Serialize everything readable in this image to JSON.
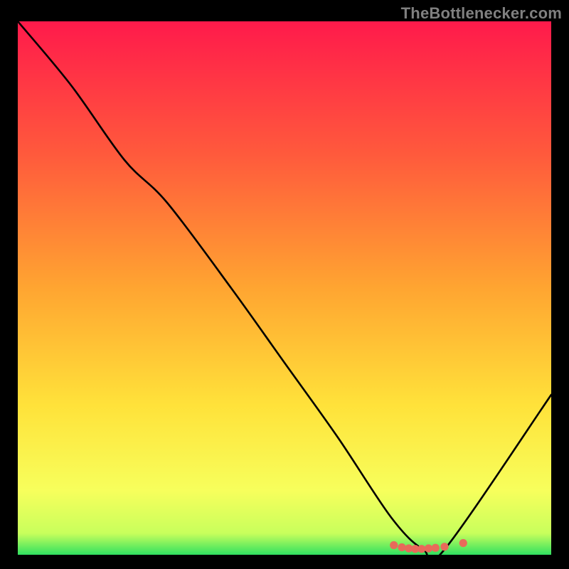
{
  "watermark": "TheBottlenecker.com",
  "chart_data": {
    "type": "line",
    "title": "",
    "xlabel": "",
    "ylabel": "",
    "xlim": [
      0,
      100
    ],
    "ylim": [
      0,
      100
    ],
    "gradient_stops": [
      {
        "offset": 0,
        "color": "#ff1a4b"
      },
      {
        "offset": 25,
        "color": "#ff5a3c"
      },
      {
        "offset": 50,
        "color": "#ffa531"
      },
      {
        "offset": 72,
        "color": "#ffe23a"
      },
      {
        "offset": 88,
        "color": "#f7ff5c"
      },
      {
        "offset": 96,
        "color": "#c8ff5c"
      },
      {
        "offset": 100,
        "color": "#30e060"
      }
    ],
    "series": [
      {
        "name": "bottleneck-curve",
        "x": [
          0,
          10,
          20,
          28,
          40,
          50,
          60,
          70,
          76,
          80,
          100
        ],
        "y": [
          100,
          88,
          74,
          66,
          50,
          36,
          22,
          7,
          1,
          1,
          30
        ]
      }
    ],
    "markers": {
      "name": "highlight-points",
      "color": "#e86a5a",
      "points": [
        {
          "x": 70.5,
          "y": 1.8
        },
        {
          "x": 72.0,
          "y": 1.4
        },
        {
          "x": 73.3,
          "y": 1.2
        },
        {
          "x": 74.5,
          "y": 1.1
        },
        {
          "x": 75.7,
          "y": 1.1
        },
        {
          "x": 77.0,
          "y": 1.2
        },
        {
          "x": 78.3,
          "y": 1.3
        },
        {
          "x": 80.0,
          "y": 1.5
        },
        {
          "x": 83.5,
          "y": 2.2
        }
      ]
    }
  }
}
